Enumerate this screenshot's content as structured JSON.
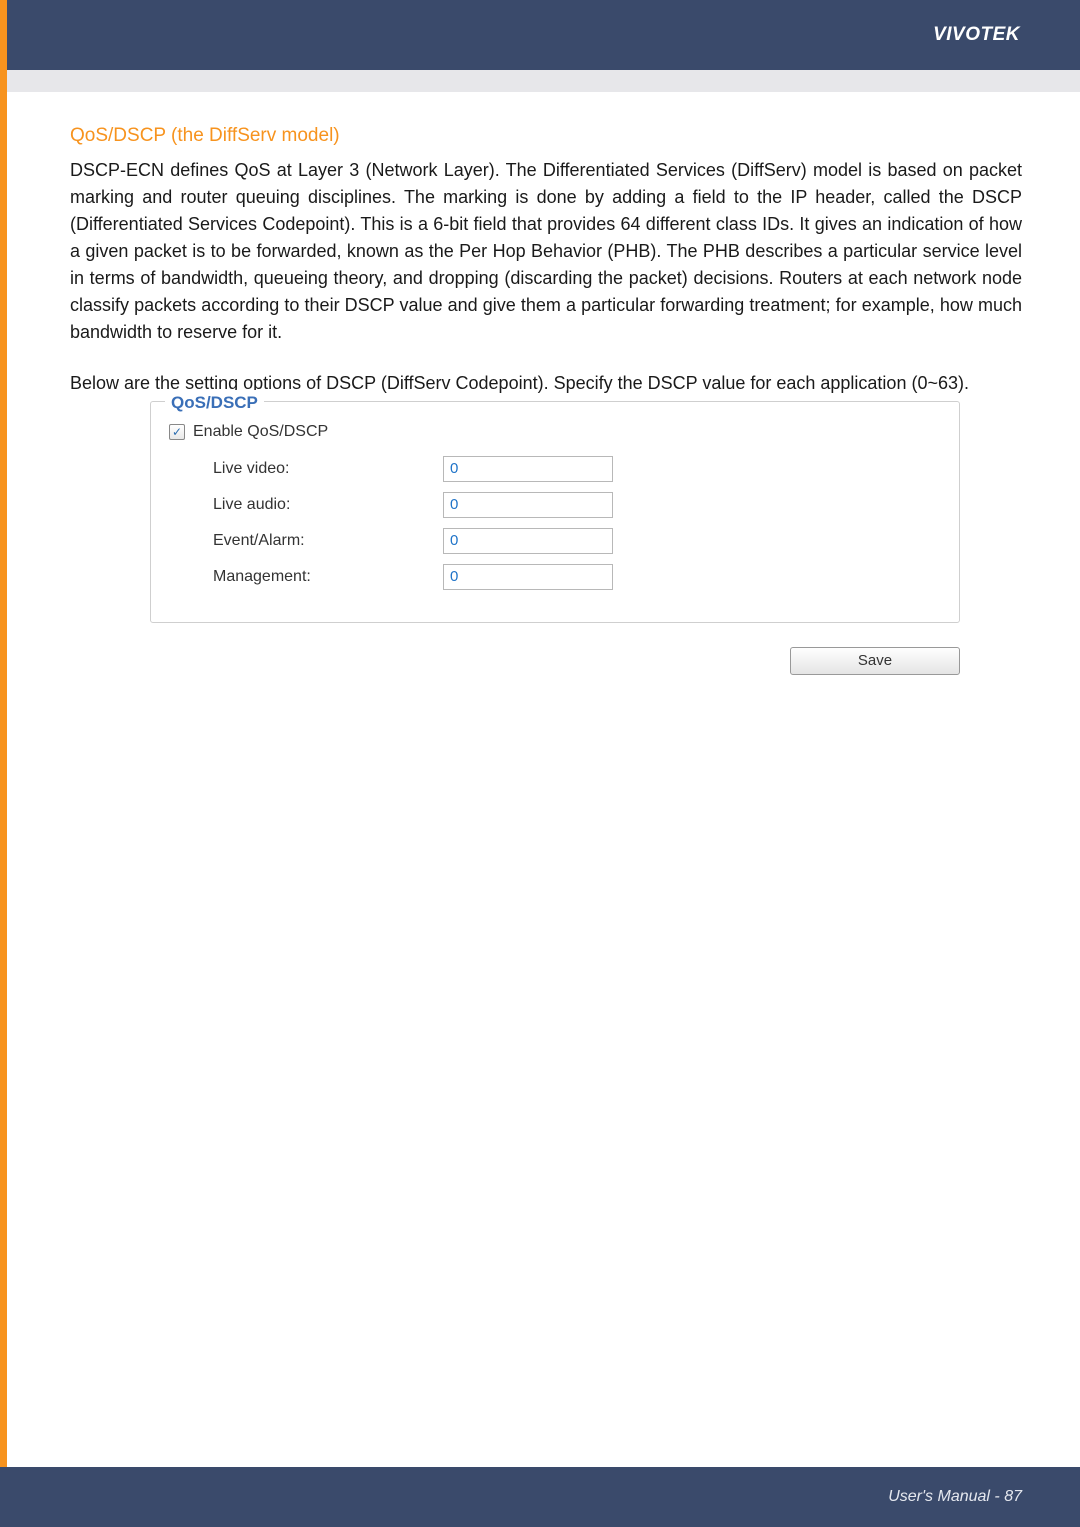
{
  "brand": "VIVOTEK",
  "section_title": "QoS/DSCP (the DiffServ model)",
  "paragraph1": "DSCP-ECN defines QoS at Layer 3 (Network Layer). The Differentiated Services (DiffServ) model is based on packet marking and router queuing disciplines. The marking is done by adding a field to the IP header, called the DSCP (Differentiated Services Codepoint). This is a 6-bit field that provides 64 different class IDs. It gives an indication of how a given packet is to be forwarded, known as the Per Hop Behavior (PHB). The PHB describes a particular service level in terms of bandwidth, queueing theory, and dropping (discarding the packet) decisions. Routers at each network node classify packets according to their DSCP value and give them a particular forwarding treatment; for example, how much bandwidth to reserve for it.",
  "paragraph2": "Below are the setting options of DSCP (DiffServ Codepoint). Specify the DSCP value for each application (0~63).",
  "range_note": "(0~63).",
  "panel": {
    "legend": "QoS/DSCP",
    "enable_label": "Enable QoS/DSCP",
    "check_mark": "✓",
    "fields": [
      {
        "label": "Live video:",
        "value": "0"
      },
      {
        "label": "Live audio:",
        "value": "0"
      },
      {
        "label": "Event/Alarm:",
        "value": "0"
      },
      {
        "label": "Management:",
        "value": "0"
      }
    ],
    "save": "Save"
  },
  "footer": "User's Manual - 87"
}
